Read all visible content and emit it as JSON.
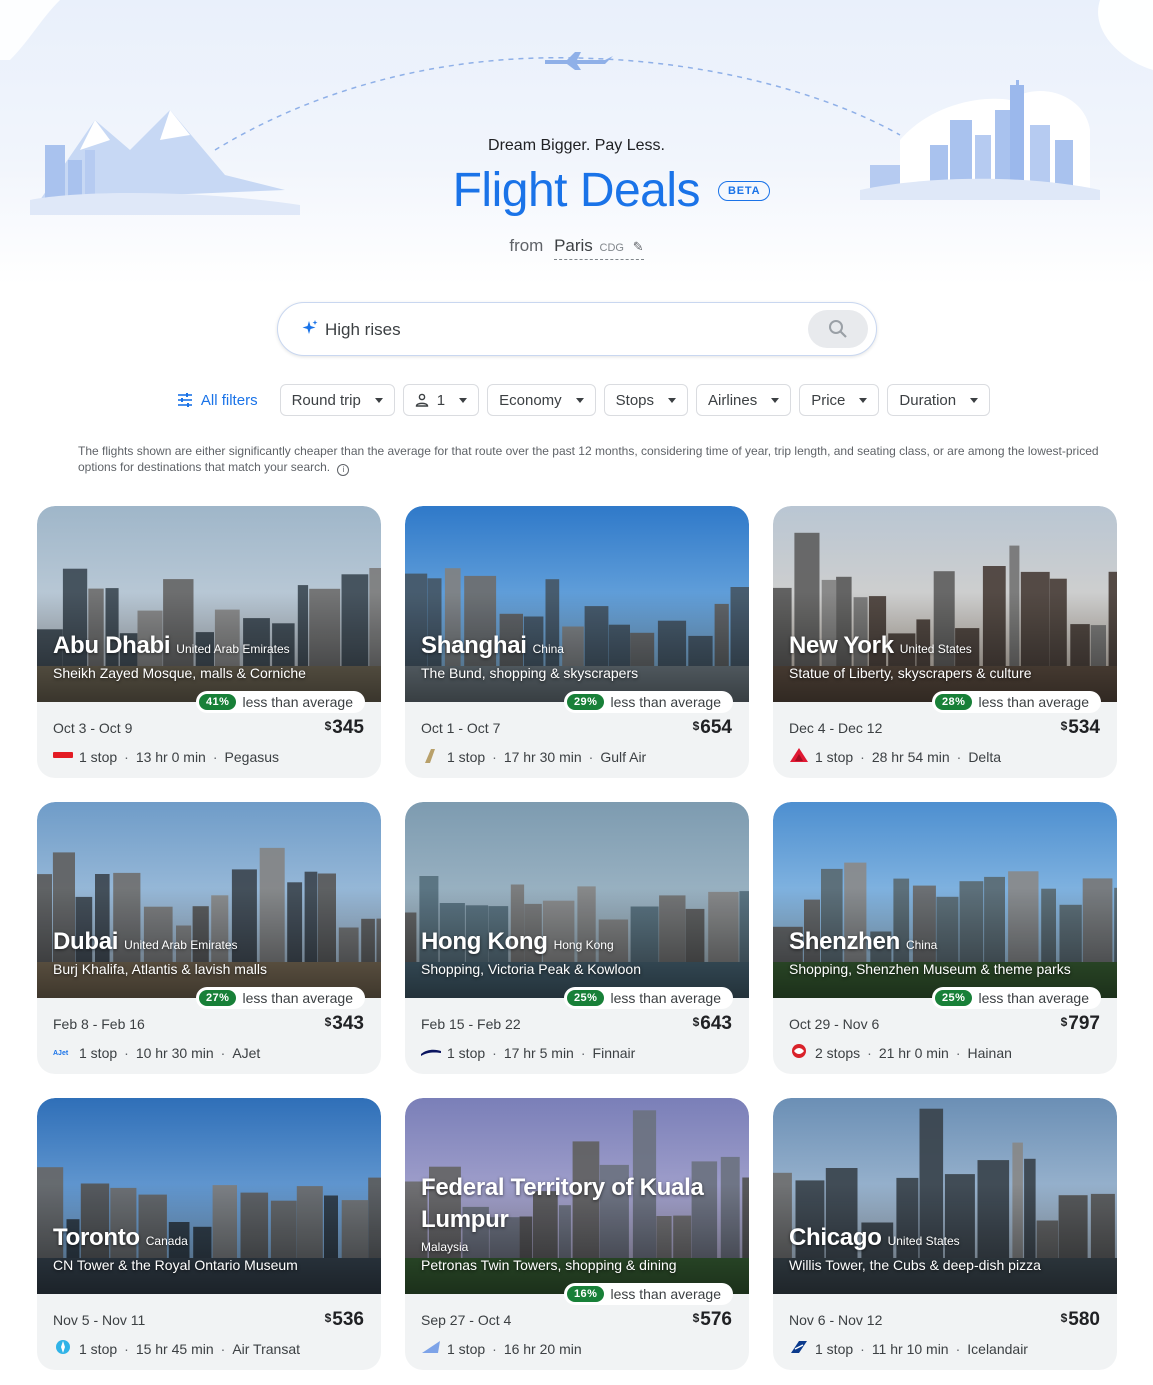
{
  "hero": {
    "tagline": "Dream Bigger. Pay Less.",
    "title": "Flight Deals",
    "beta": "BETA",
    "from_label": "from",
    "origin_city": "Paris",
    "origin_code": "CDG"
  },
  "search": {
    "value": "High rises",
    "icon": "sparkle-icon",
    "button_icon": "search-icon"
  },
  "filters": {
    "all_filters": "All filters",
    "chips": [
      "Round trip",
      "1",
      "Economy",
      "Stops",
      "Airlines",
      "Price",
      "Duration"
    ]
  },
  "disclaimer": "The flights shown are either significantly cheaper than the average for that route over the past 12 months, considering time of year, trip length, and seating class, or are among the lowest-priced options for destinations that match your search.",
  "badge_suffix": "less than average",
  "currency": "$",
  "colors": {
    "accent": "#1a73e8",
    "badge_green": "#188038"
  },
  "deals": [
    {
      "city": "Abu Dhabi",
      "country": "United Arab Emirates",
      "desc": "Sheikh Zayed Mosque, malls & Corniche",
      "pct": "41%",
      "dates": "Oct 3 - Oct 9",
      "price": "345",
      "stops": "1 stop",
      "duration": "13 hr 0 min",
      "airline": "Pegasus",
      "logo": "pegasus-logo-icon"
    },
    {
      "city": "Shanghai",
      "country": "China",
      "desc": "The Bund, shopping & skyscrapers",
      "pct": "29%",
      "dates": "Oct 1 - Oct 7",
      "price": "654",
      "stops": "1 stop",
      "duration": "17 hr 30 min",
      "airline": "Gulf Air",
      "logo": "gulf-air-logo-icon"
    },
    {
      "city": "New York",
      "country": "United States",
      "desc": "Statue of Liberty, skyscrapers & culture",
      "pct": "28%",
      "dates": "Dec 4 - Dec 12",
      "price": "534",
      "stops": "1 stop",
      "duration": "28 hr 54 min",
      "airline": "Delta",
      "logo": "delta-logo-icon"
    },
    {
      "city": "Dubai",
      "country": "United Arab Emirates",
      "desc": "Burj Khalifa, Atlantis & lavish malls",
      "pct": "27%",
      "dates": "Feb 8 - Feb 16",
      "price": "343",
      "stops": "1 stop",
      "duration": "10 hr 30 min",
      "airline": "AJet",
      "logo": "ajet-logo-icon"
    },
    {
      "city": "Hong Kong",
      "country": "Hong Kong",
      "desc": "Shopping, Victoria Peak & Kowloon",
      "pct": "25%",
      "dates": "Feb 15 - Feb 22",
      "price": "643",
      "stops": "1 stop",
      "duration": "17 hr 5 min",
      "airline": "Finnair",
      "logo": "finnair-logo-icon"
    },
    {
      "city": "Shenzhen",
      "country": "China",
      "desc": "Shopping, Shenzhen Museum & theme parks",
      "pct": "25%",
      "dates": "Oct 29 - Nov 6",
      "price": "797",
      "stops": "2 stops",
      "duration": "21 hr 0 min",
      "airline": "Hainan",
      "logo": "hainan-logo-icon"
    },
    {
      "city": "Toronto",
      "country": "Canada",
      "desc": "CN Tower & the Royal Ontario Museum",
      "pct": "",
      "dates": "Nov 5 - Nov 11",
      "price": "536",
      "stops": "1 stop",
      "duration": "15 hr 45 min",
      "airline": "Air Transat",
      "logo": "air-transat-logo-icon"
    },
    {
      "city": "Federal Territory of Kuala Lumpur",
      "city_line1": "Federal Territory of Kuala",
      "city_line2": "Lumpur",
      "country": "Malaysia",
      "desc": "Petronas Twin Towers, shopping & dining",
      "pct": "16%",
      "dates": "Sep 27 - Oct 4",
      "price": "576",
      "stops": "1 stop",
      "duration": "16 hr 20 min",
      "airline": "",
      "logo": "airline-logo-icon"
    },
    {
      "city": "Chicago",
      "country": "United States",
      "desc": "Willis Tower, the Cubs & deep-dish pizza",
      "pct": "",
      "dates": "Nov 6 - Nov 12",
      "price": "580",
      "stops": "1 stop",
      "duration": "11 hr 10 min",
      "airline": "Icelandair",
      "logo": "icelandair-logo-icon"
    }
  ]
}
